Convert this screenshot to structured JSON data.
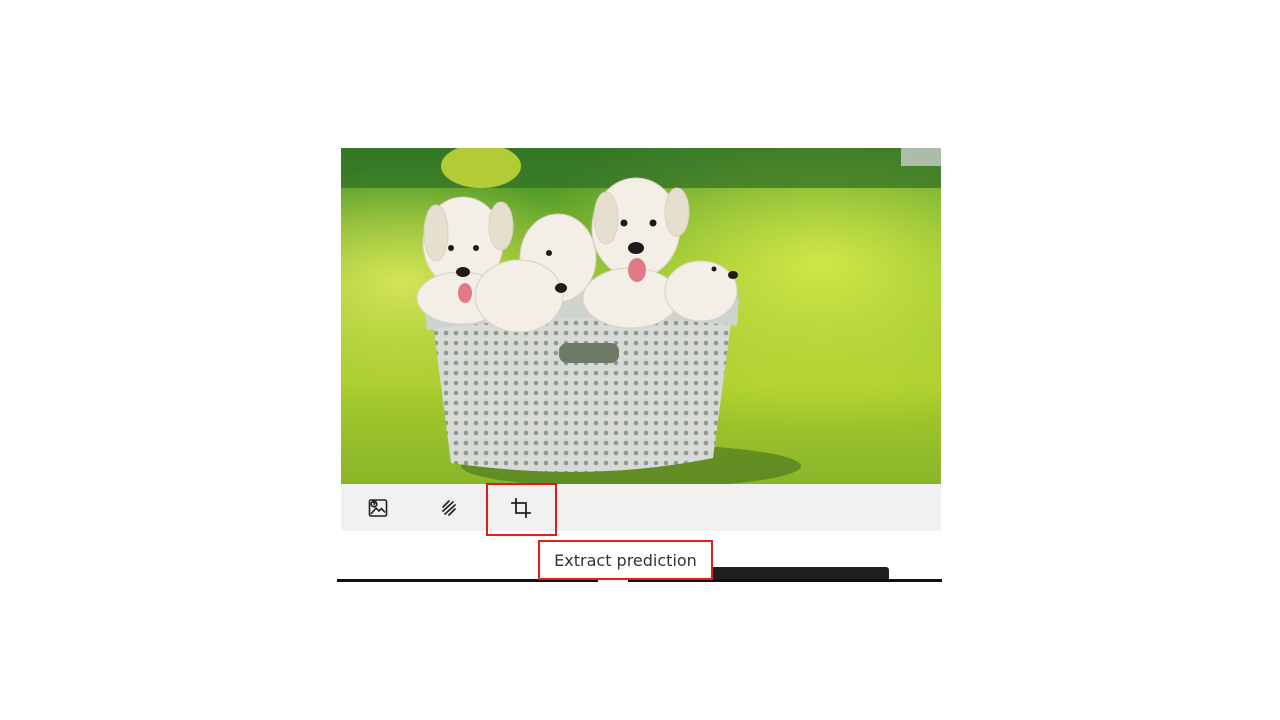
{
  "image": {
    "alt": "Five white labrador puppies sitting in a grey basket on green grass",
    "icon": "photo"
  },
  "toolbar": {
    "buttons": [
      {
        "name": "image-prediction",
        "icon": "image-icon"
      },
      {
        "name": "segment",
        "icon": "brush-strokes-icon"
      },
      {
        "name": "extract",
        "icon": "crop-icon"
      }
    ]
  },
  "tooltip": {
    "text": "Extract prediction"
  },
  "colors": {
    "highlight": "#e31b1b",
    "toolbar_bg": "#f1f1f1",
    "icon": "#222222"
  }
}
